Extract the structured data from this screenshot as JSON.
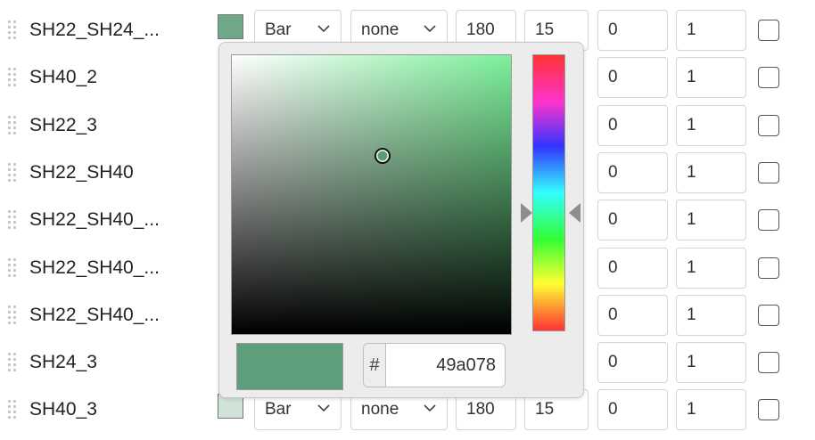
{
  "rows": [
    {
      "name": "SH22_SH24_...",
      "swatch": "#6fa888",
      "chart_type": "Bar",
      "style": "none",
      "v1": "180",
      "v2": "15",
      "v3": "0",
      "v4": "1"
    },
    {
      "name": "SH40_2",
      "v3": "0",
      "v4": "1"
    },
    {
      "name": "SH22_3",
      "v3": "0",
      "v4": "1"
    },
    {
      "name": "SH22_SH40",
      "v3": "0",
      "v4": "1"
    },
    {
      "name": "SH22_SH40_...",
      "v3": "0",
      "v4": "1"
    },
    {
      "name": "SH22_SH40_...",
      "v3": "0",
      "v4": "1"
    },
    {
      "name": "SH22_SH40_...",
      "v3": "0",
      "v4": "1"
    },
    {
      "name": "SH24_3",
      "v3": "0",
      "v4": "1"
    },
    {
      "name": "SH40_3",
      "swatch": "#cfe3d6",
      "chart_type": "Bar",
      "style": "none",
      "v1": "180",
      "v2": "15",
      "v3": "0",
      "v4": "1"
    }
  ],
  "color_picker": {
    "hash_label": "#",
    "hex_value": "49a078",
    "preview_color": "#5e9e7a",
    "hue_color": "#7cf09a"
  },
  "icons": {
    "drag": "drag-handle-icon",
    "chevron": "chevron-down-icon",
    "checkbox": "checkbox-icon"
  }
}
